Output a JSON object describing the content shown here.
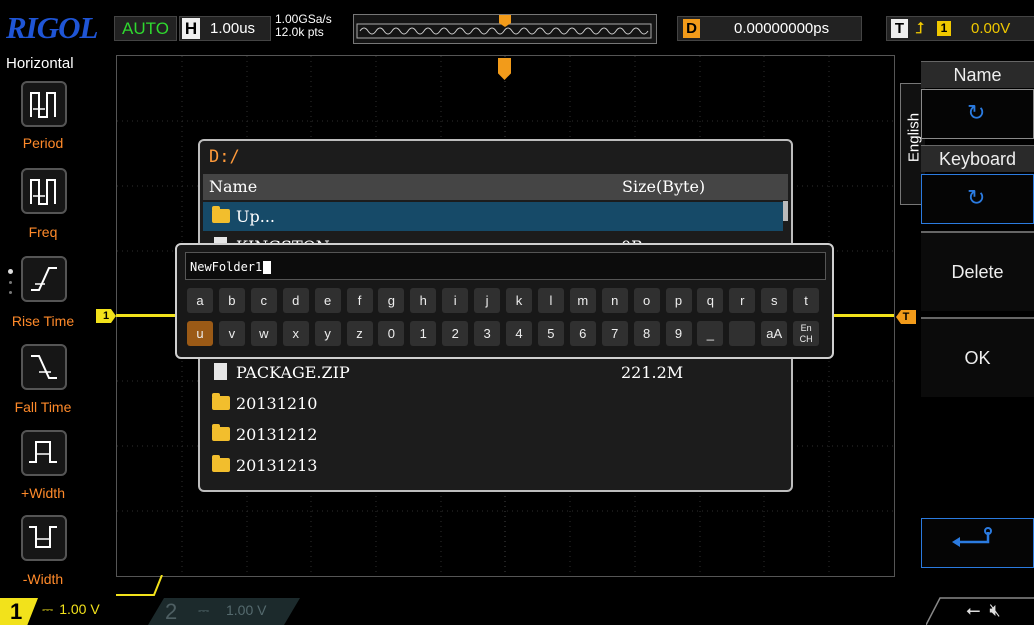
{
  "top": {
    "logo": "RIGOL",
    "run_status": "AUTO",
    "horizontal_label": "H",
    "horizontal_value": "1.00us",
    "sample_rate": "1.00GSa/s",
    "memory_depth": "12.0k pts",
    "delay_label": "D",
    "delay_value": "0.00000000ps",
    "trigger_label": "T",
    "trigger_source": "1",
    "trigger_level": "0.00V"
  },
  "left_menu": {
    "title": "Horizontal",
    "items": [
      {
        "label": "Period"
      },
      {
        "label": "Freq"
      },
      {
        "label": "Rise Time"
      },
      {
        "label": "Fall Time"
      },
      {
        "label": "+Width"
      },
      {
        "label": "-Width"
      }
    ]
  },
  "right_menu": {
    "tab_label": "English",
    "name_header": "Name",
    "keyboard_header": "Keyboard",
    "delete_label": "Delete",
    "ok_label": "OK"
  },
  "file_dialog": {
    "path": "D:/",
    "col_name": "Name",
    "col_size": "Size(Byte)",
    "rows": [
      {
        "name": "Up...",
        "size": "",
        "type": "up"
      },
      {
        "name": "KINGSTON",
        "size": "0B",
        "type": "file"
      },
      {
        "name": "PACKAGE.ZIP",
        "size": "221.2M",
        "type": "file"
      },
      {
        "name": "20131210",
        "size": "",
        "type": "folder"
      },
      {
        "name": "20131212",
        "size": "",
        "type": "folder"
      },
      {
        "name": "20131213",
        "size": "",
        "type": "folder"
      }
    ]
  },
  "keyboard": {
    "input_value": "NewFolder1",
    "row1": [
      "a",
      "b",
      "c",
      "d",
      "e",
      "f",
      "g",
      "h",
      "i",
      "j",
      "k",
      "l",
      "m",
      "n",
      "o",
      "p",
      "q",
      "r",
      "s",
      "t"
    ],
    "row2": [
      "u",
      "v",
      "w",
      "x",
      "y",
      "z",
      "0",
      "1",
      "2",
      "3",
      "4",
      "5",
      "6",
      "7",
      "8",
      "9",
      "_",
      " ",
      "aA",
      "En CH"
    ],
    "selected_key": "u"
  },
  "channels": {
    "ch1_label": "1",
    "ch1_scale": "1.00 V",
    "ch2_label": "2",
    "ch2_scale": "1.00 V",
    "ch1_marker": "1",
    "trigger_marker": "T"
  },
  "colors": {
    "ch1": "#f2e21b",
    "trigger": "#f29b1a",
    "accent": "#2b7be0"
  }
}
